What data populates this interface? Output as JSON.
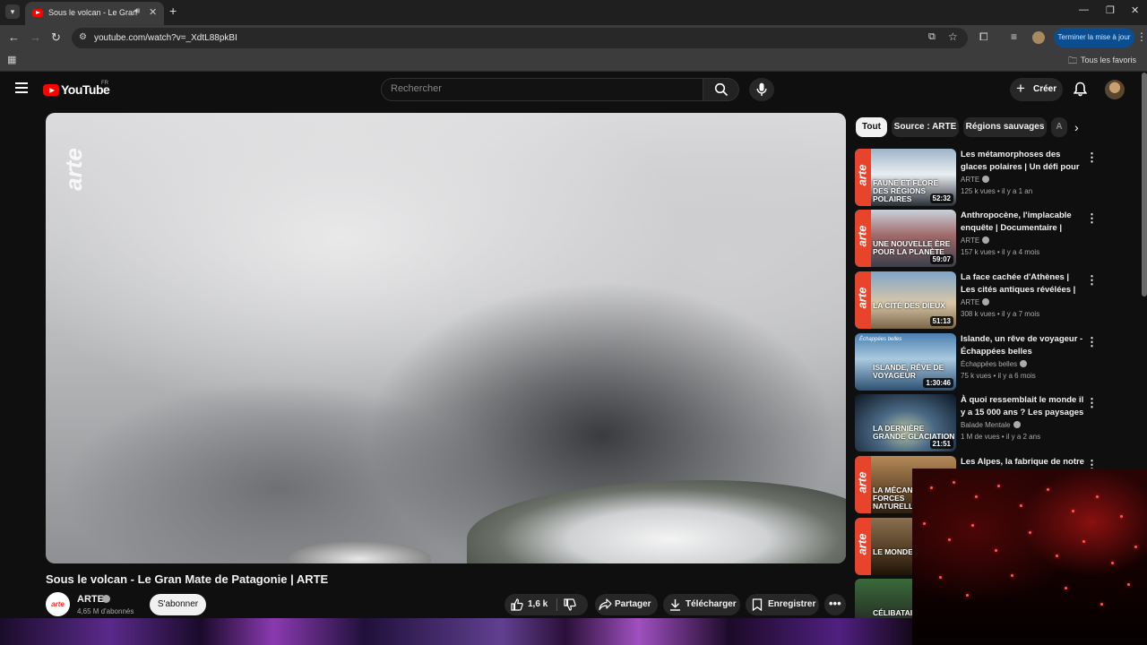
{
  "browser": {
    "tab_title": "Sous le volcan - Le Gran Mate de Patagonie | ARTE",
    "url": "youtube.com/watch?v=_XdtL88pkBI",
    "update_button": "Terminer la mise à jour",
    "bookmarks_all": "Tous les favoris"
  },
  "header": {
    "logo": "YouTube",
    "region": "FR",
    "search_placeholder": "Rechercher",
    "create_label": "Créer"
  },
  "video": {
    "watermark": "arte",
    "title": "Sous le volcan - Le Gran Mate de Patagonie | ARTE",
    "channel": "ARTE",
    "channel_logo": "arte",
    "subscribers": "4,65 M d'abonnés",
    "subscribe_label": "S'abonner",
    "likes": "1,6 k",
    "share_label": "Partager",
    "download_label": "Télécharger",
    "save_label": "Enregistrer"
  },
  "chips": [
    "Tout",
    "Source : ARTE",
    "Régions sauvages",
    "A"
  ],
  "recommendations": [
    {
      "title": "Les métamorphoses des glaces polaires | Un défi pour les ...",
      "channel": "ARTE",
      "views": "125 k vues",
      "age": "il y a 1 an",
      "duration": "52:32",
      "thumb_text": "Faune et flore des régions polaires",
      "thumb_brand": "arte"
    },
    {
      "title": "Anthropocène, l'implacable enquête | Documentaire | ARTE",
      "channel": "ARTE",
      "views": "157 k vues",
      "age": "il y a 4 mois",
      "duration": "59:07",
      "thumb_text": "Une nouvelle ère pour la planète",
      "thumb_brand": "arte"
    },
    {
      "title": "La face cachée d'Athènes | Les cités antiques révélées | ARTE",
      "channel": "ARTE",
      "views": "308 k vues",
      "age": "il y a 7 mois",
      "duration": "51:13",
      "thumb_text": "La cité des dieux",
      "thumb_brand": "arte"
    },
    {
      "title": "Islande, un rêve de voyageur - Échappées belles",
      "channel": "Échappées belles",
      "views": "75 k vues",
      "age": "il y a 6 mois",
      "duration": "1:30:46",
      "thumb_text": "Islande, rêve de voyageur",
      "thumb_brand": "Échappées belles"
    },
    {
      "title": "À quoi ressemblait le monde il y a 15 000 ans ? Les paysages ...",
      "channel": "Balade Mentale",
      "views": "1 M de vues",
      "age": "il y a 2 ans",
      "duration": "21:51",
      "thumb_text": "La dernière grande glaciation",
      "thumb_brand": ""
    },
    {
      "title": "Les Alpes, la fabrique de notre",
      "channel": "",
      "views": "",
      "age": "",
      "duration": "",
      "thumb_text": "La mécanique des forces naturelles",
      "thumb_brand": "arte"
    },
    {
      "title": "",
      "channel": "",
      "views": "",
      "age": "",
      "duration": "",
      "thumb_text": "Le monde des rats",
      "thumb_brand": "arte"
    },
    {
      "title": "",
      "channel": "",
      "views": "",
      "age": "",
      "duration": "",
      "thumb_text": "Célibataire",
      "thumb_brand": ""
    }
  ],
  "colors": {
    "accent": "#ff0000",
    "arte": "#e8432b",
    "update": "#0b4d8f"
  }
}
